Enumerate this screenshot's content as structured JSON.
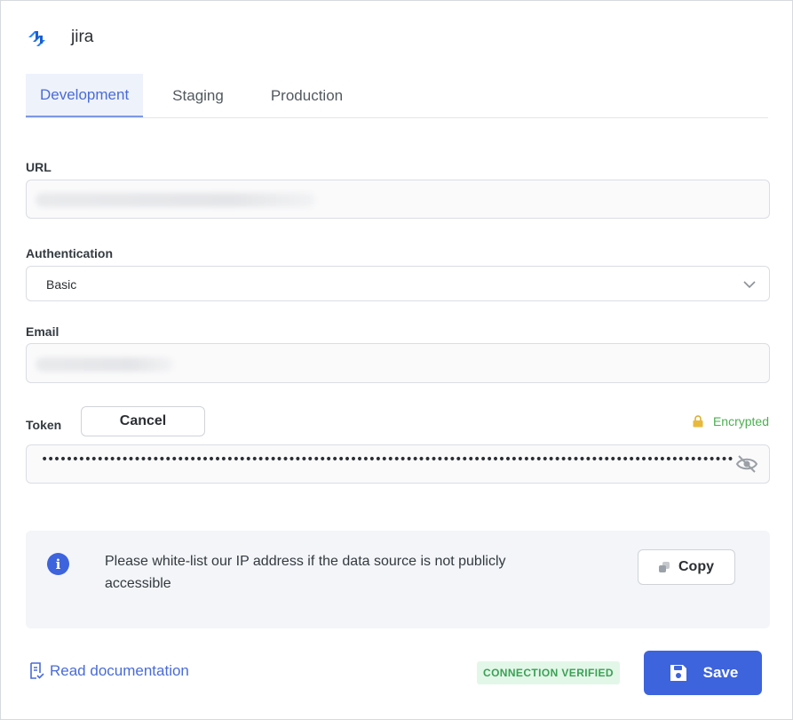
{
  "header": {
    "title": "jira",
    "logo_icon": "jira-logo-icon"
  },
  "tabs": [
    {
      "label": "Development",
      "active": true
    },
    {
      "label": "Staging",
      "active": false
    },
    {
      "label": "Production",
      "active": false
    }
  ],
  "form": {
    "url": {
      "label": "URL",
      "value": ""
    },
    "authentication": {
      "label": "Authentication",
      "value": "Basic"
    },
    "email": {
      "label": "Email",
      "value": ""
    },
    "token": {
      "label": "Token",
      "cancel_label": "Cancel",
      "encrypted_label": "Encrypted",
      "masked_value": "••••••••••••••••••••••••••••••••••••••••••••••••••••••••••••••••••••••••••••••••••••••••••••••••••••••••••••••••••••••••••••••"
    }
  },
  "info": {
    "text": "Please white-list our IP address if the data source is not publicly accessible",
    "copy_label": "Copy"
  },
  "footer": {
    "docs_label": "Read documentation",
    "status_badge": "CONNECTION VERIFIED",
    "save_label": "Save"
  },
  "colors": {
    "accent": "#3d63dd",
    "success": "#4caf50",
    "lock": "#e8b93a"
  }
}
